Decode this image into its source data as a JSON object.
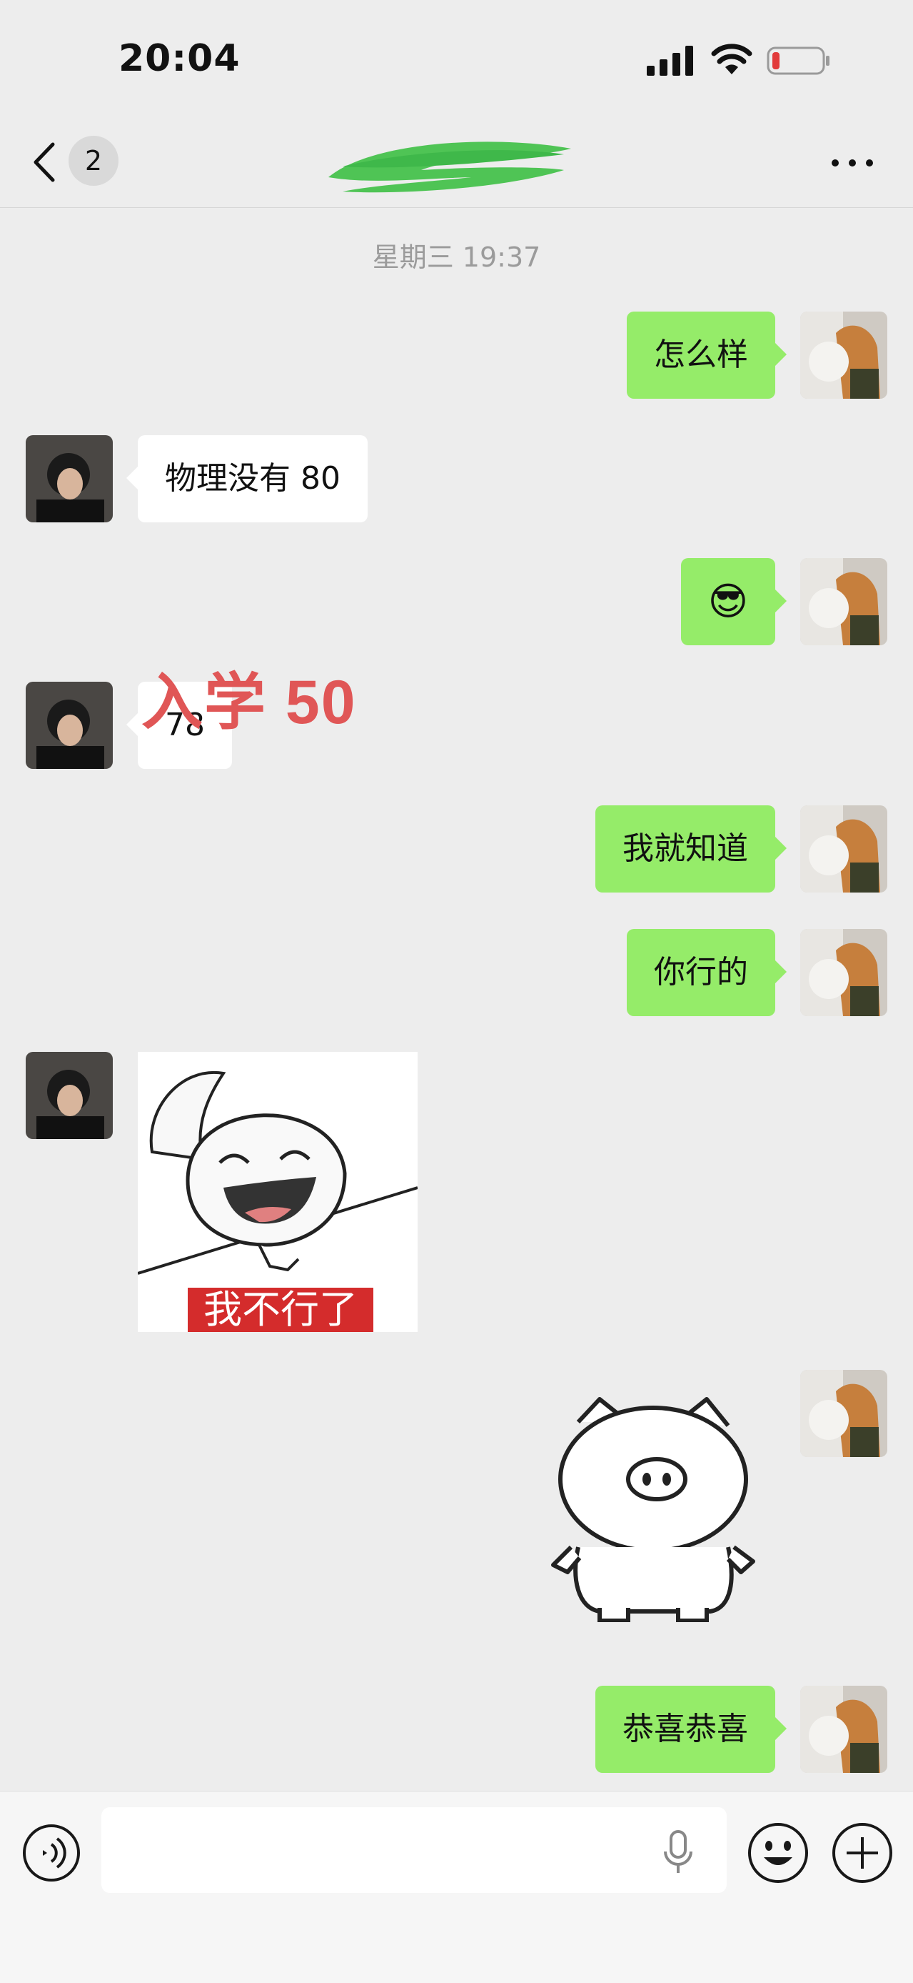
{
  "status_bar": {
    "time": "20:04"
  },
  "nav": {
    "unread_count": "2"
  },
  "chat": {
    "timestamp": "星期三 19:37",
    "messages": [
      {
        "from": "me",
        "type": "text",
        "text": "怎么样"
      },
      {
        "from": "contact",
        "type": "text",
        "text": "物理没有 80"
      },
      {
        "from": "me",
        "type": "emoji",
        "emoji": "😎"
      },
      {
        "from": "contact",
        "type": "text",
        "text": "78"
      },
      {
        "from": "me",
        "type": "text",
        "text": "我就知道"
      },
      {
        "from": "me",
        "type": "text",
        "text": "你行的"
      },
      {
        "from": "contact",
        "type": "sticker",
        "caption": "我不行了"
      },
      {
        "from": "me",
        "type": "sticker",
        "sticker": "pig-sticker"
      },
      {
        "from": "me",
        "type": "text",
        "text": "恭喜恭喜"
      }
    ],
    "overlay_annotation": "入学 50"
  },
  "input_bar": {
    "value": ""
  },
  "colors": {
    "outgoing_bubble": "#95ec69",
    "incoming_bubble": "#ffffff",
    "background": "#ededed",
    "annotation": "#e05656"
  }
}
